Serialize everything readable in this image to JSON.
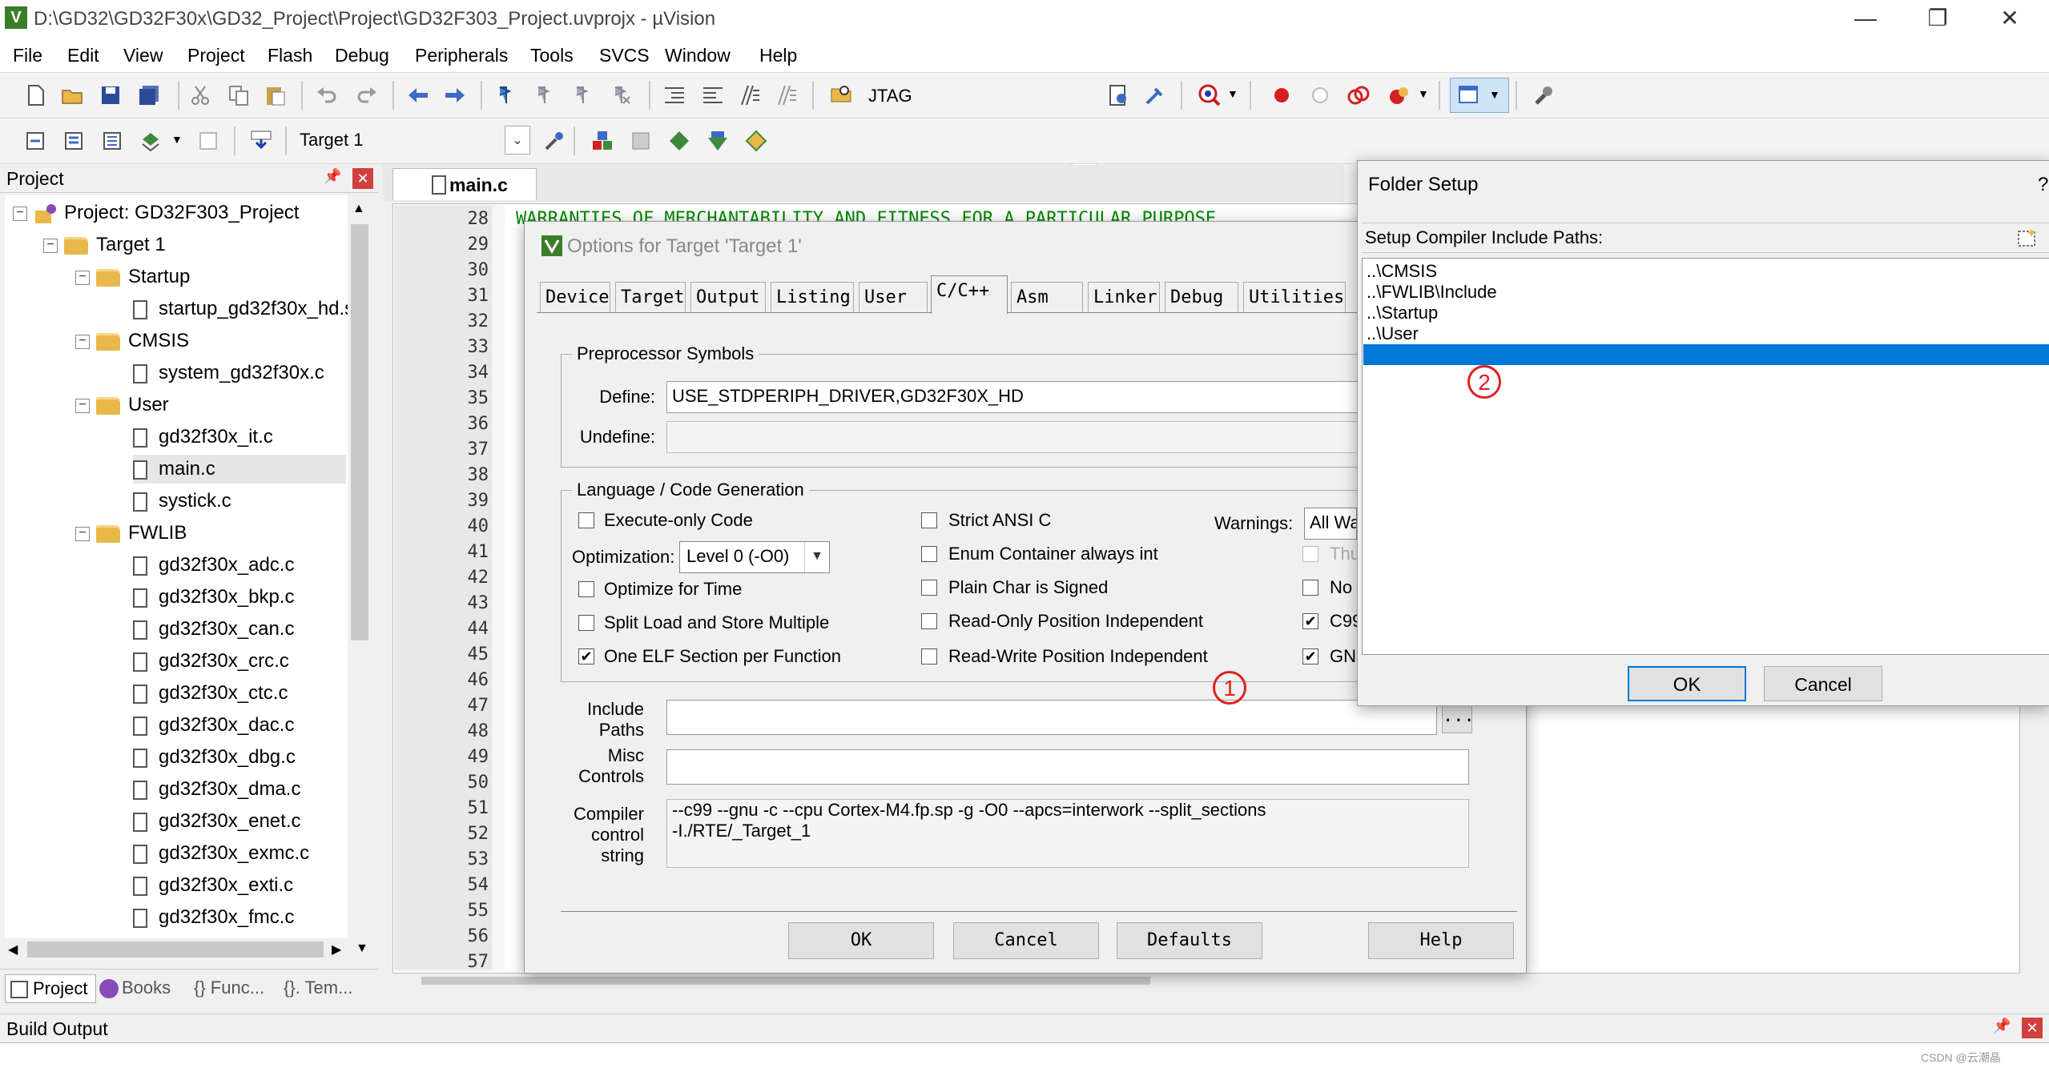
{
  "window": {
    "title": "D:\\GD32\\GD32F30x\\GD32_Project\\Project\\GD32F303_Project.uvprojx - µVision",
    "app_icon": "V",
    "minimize": "—",
    "maximize": "❐",
    "close": "✕"
  },
  "menu": [
    "File",
    "Edit",
    "View",
    "Project",
    "Flash",
    "Debug",
    "Peripherals",
    "Tools",
    "SVCS",
    "Window",
    "Help"
  ],
  "toolbar": {
    "debugger": "JTAG",
    "target": "Target 1"
  },
  "project_panel": {
    "title": "Project",
    "pin": "📌",
    "close": "✕",
    "tree": {
      "root": "Project: GD32F303_Project",
      "target": "Target 1",
      "groups": [
        {
          "name": "Startup",
          "files": [
            "startup_gd32f30x_hd.s"
          ]
        },
        {
          "name": "CMSIS",
          "files": [
            "system_gd32f30x.c"
          ]
        },
        {
          "name": "User",
          "files": [
            "gd32f30x_it.c",
            "main.c",
            "systick.c"
          ]
        },
        {
          "name": "FWLIB",
          "files": [
            "gd32f30x_adc.c",
            "gd32f30x_bkp.c",
            "gd32f30x_can.c",
            "gd32f30x_crc.c",
            "gd32f30x_ctc.c",
            "gd32f30x_dac.c",
            "gd32f30x_dbg.c",
            "gd32f30x_dma.c",
            "gd32f30x_enet.c",
            "gd32f30x_exmc.c",
            "gd32f30x_exti.c",
            "gd32f30x_fmc.c"
          ]
        }
      ]
    },
    "tabs": [
      "Project",
      "Books",
      "{} Func...",
      "{}. Tem..."
    ]
  },
  "editor": {
    "tab": "main.c",
    "line_numbers": [
      "28",
      "29",
      "30",
      "31",
      "32",
      "33",
      "34",
      "35",
      "36",
      "37",
      "38",
      "39",
      "40",
      "41",
      "42",
      "43",
      "44",
      "45",
      "46",
      "47",
      "48",
      "49",
      "50",
      "51",
      "52",
      "53",
      "54",
      "55",
      "56",
      "57"
    ],
    "first_line_text": "WARRANTIES OF MERCHANTABILITY AND FITNESS FOR A PARTICULAR PURPOSE"
  },
  "options_dialog": {
    "title": "Options for Target 'Target 1'",
    "tabs": [
      "Device",
      "Target",
      "Output",
      "Listing",
      "User",
      "C/C++",
      "Asm",
      "Linker",
      "Debug",
      "Utilities"
    ],
    "active_tab": "C/C++",
    "preprocessor": {
      "group_label": "Preprocessor Symbols",
      "define_label": "Define:",
      "define_value": "USE_STDPERIPH_DRIVER,GD32F30X_HD",
      "undefine_label": "Undefine:",
      "undefine_value": ""
    },
    "language": {
      "group_label": "Language / Code Generation",
      "execute_only": "Execute-only Code",
      "optimization_label": "Optimization:",
      "optimization_value": "Level 0 (-O0)",
      "optimize_time": "Optimize for Time",
      "split_load": "Split Load and Store Multiple",
      "one_elf": "One ELF Section per Function",
      "strict_ansi": "Strict ANSI C",
      "enum_container": "Enum Container always int",
      "plain_char": "Plain Char is Signed",
      "ro_pi": "Read-Only Position Independent",
      "rw_pi": "Read-Write Position Independent",
      "warnings_label": "Warnings:",
      "warnings_value": "All Wa",
      "thumb_label": "Thu",
      "no_label": "No",
      "c99_label": "C99",
      "gnu_label": "GN",
      "check_mark": "✔"
    },
    "include_label_1": "Include",
    "include_label_2": "Paths",
    "include_value": "",
    "browse_label": "...",
    "misc_label_1": "Misc",
    "misc_label_2": "Controls",
    "misc_value": "",
    "compiler_label_1": "Compiler",
    "compiler_label_2": "control",
    "compiler_label_3": "string",
    "compiler_line_1": "--c99 --gnu -c --cpu Cortex-M4.fp.sp -g -O0 --apcs=interwork --split_sections",
    "compiler_line_2": "-I./RTE/_Target_1",
    "buttons": {
      "ok": "OK",
      "cancel": "Cancel",
      "defaults": "Defaults",
      "help": "Help"
    }
  },
  "folder_setup": {
    "title": "Folder Setup",
    "help_mark": "?",
    "subtitle": "Setup Compiler Include Paths:",
    "paths": [
      "..\\CMSIS",
      "..\\FWLIB\\Include",
      "..\\Startup",
      "..\\User"
    ],
    "ok": "OK",
    "cancel": "Cancel"
  },
  "callouts": {
    "one": "1",
    "two": "2"
  },
  "build_output": {
    "title": "Build Output",
    "pin": "📌",
    "close": "✕",
    "watermark": "CSDN @云潮晶"
  },
  "colors": {
    "accent": "#0078d7",
    "callout": "#e02020",
    "code_green": "#008000"
  }
}
